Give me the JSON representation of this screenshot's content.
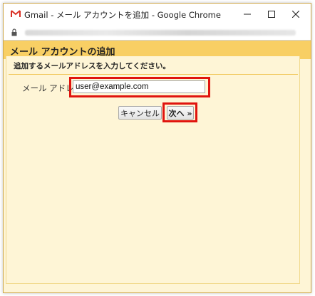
{
  "window": {
    "title": "Gmail - メール アカウントを追加 - Google Chrome"
  },
  "icons": {
    "app": "gmail-icon",
    "secure": "lock-icon",
    "minimize": "minimize-icon",
    "maximize": "maximize-icon",
    "close": "close-icon"
  },
  "dialog": {
    "heading": "メール アカウントの追加",
    "instruction": "追加するメールアドレスを入力してください。",
    "email_label": "メール アドレス:",
    "email_value": "user@example.com",
    "cancel_label": "キャンセル",
    "next_label": "次へ »"
  },
  "colors": {
    "header_bg": "#f8cf64",
    "panel_bg": "#fef5d6",
    "highlight": "#e0140e"
  }
}
